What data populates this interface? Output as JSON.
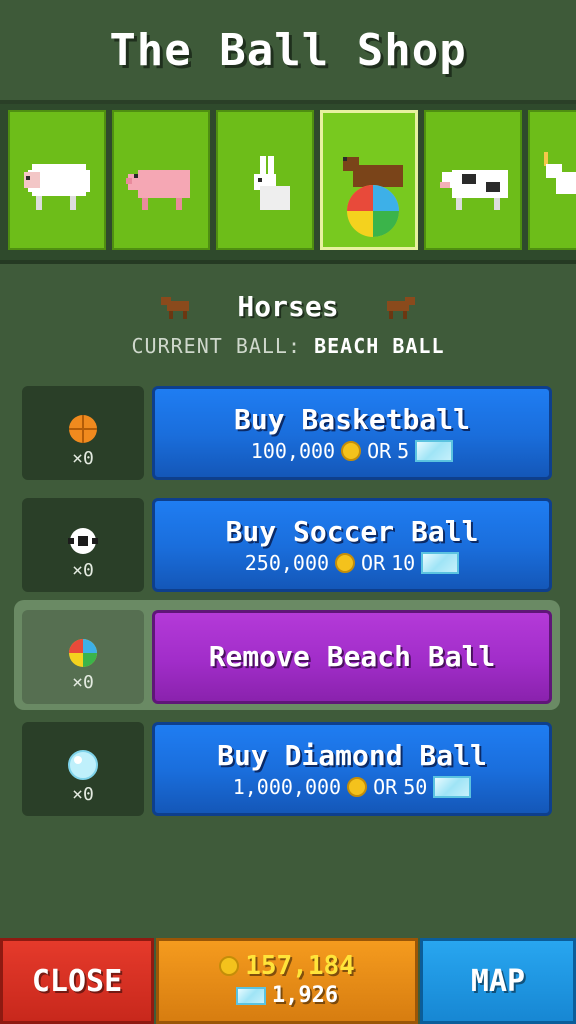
{
  "header": {
    "title": "The Ball Shop"
  },
  "animals": [
    {
      "icon": "sheep-icon",
      "selected": false
    },
    {
      "icon": "pig-icon",
      "selected": false
    },
    {
      "icon": "rabbit-icon",
      "selected": false
    },
    {
      "icon": "horse-with-beach-ball-icon",
      "selected": true
    },
    {
      "icon": "cow-icon",
      "selected": false
    },
    {
      "icon": "unicorn-icon",
      "selected": false
    }
  ],
  "category": {
    "name": "Horses",
    "icon": "horse-icon"
  },
  "current_ball": {
    "label": "CURRENT BALL:",
    "value": "BEACH BALL"
  },
  "balls": [
    {
      "icon": "basketball-icon",
      "count": "×0",
      "title": "Buy Basketball",
      "coins": "100,000",
      "or": "OR",
      "gems": "5"
    },
    {
      "icon": "soccer-ball-icon",
      "count": "×0",
      "title": "Buy Soccer Ball",
      "coins": "250,000",
      "or": "OR",
      "gems": "10"
    },
    {
      "icon": "beach-ball-icon",
      "count": "×0",
      "title": "Remove Beach Ball"
    },
    {
      "icon": "diamond-ball-icon",
      "count": "×0",
      "title": "Buy Diamond Ball",
      "coins": "1,000,000",
      "or": "OR",
      "gems": "50"
    }
  ],
  "footer": {
    "close_label": "CLOSE",
    "coins": "157,184",
    "gems": "1,926",
    "map_label": "MAP"
  },
  "colors": {
    "background": "#3f5b3a",
    "grass": "#6dbd19",
    "buy_button": "#1a6edc",
    "remove_button": "#a12dc9",
    "close_button": "#d4301f",
    "money_panel": "#e98c16",
    "map_button": "#1f98e2"
  }
}
